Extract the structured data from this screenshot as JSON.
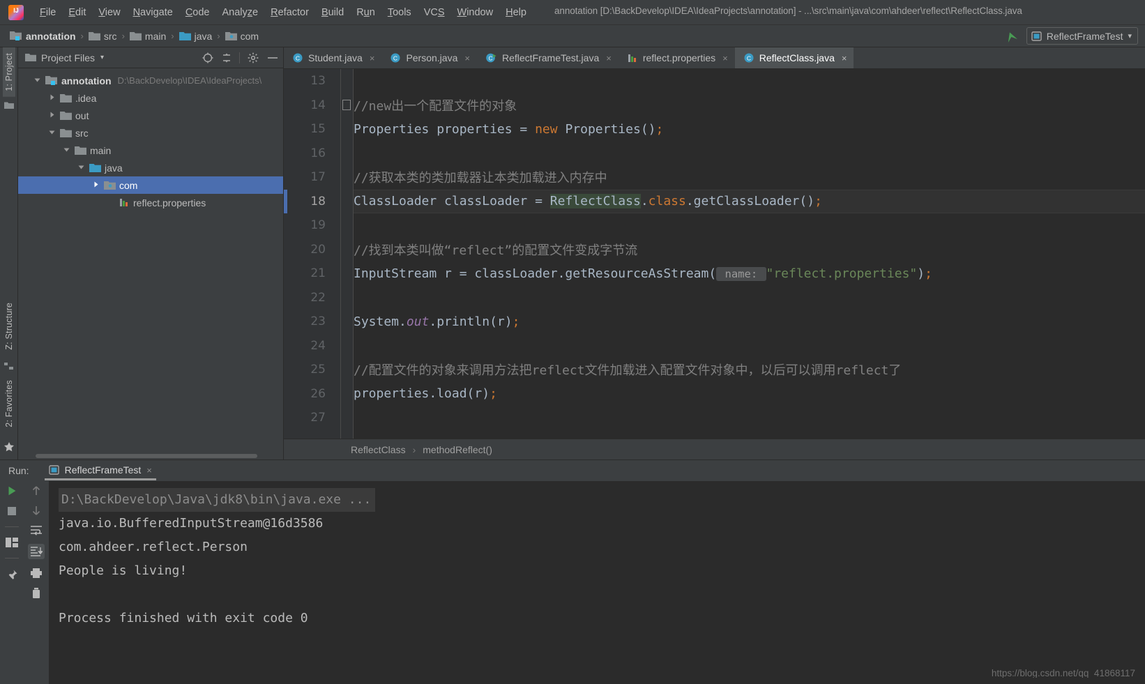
{
  "window": {
    "title": "annotation [D:\\BackDevelop\\IDEA\\IdeaProjects\\annotation] - ...\\src\\main\\java\\com\\ahdeer\\reflect\\ReflectClass.java"
  },
  "menubar": {
    "logo": "intellij-idea-logo",
    "items": [
      {
        "label": "File",
        "pre": "F",
        "mid": "ile"
      },
      {
        "label": "Edit",
        "pre": "E",
        "mid": "dit"
      },
      {
        "label": "View",
        "pre": "V",
        "mid": "iew"
      },
      {
        "label": "Navigate",
        "pre": "N",
        "mid": "avigate"
      },
      {
        "label": "Code",
        "pre": "C",
        "mid": "ode"
      },
      {
        "label": "Analyze",
        "pre": "z",
        "mid": "Analyze"
      },
      {
        "label": "Refactor",
        "pre": "R",
        "mid": "efactor"
      },
      {
        "label": "Build",
        "pre": "B",
        "mid": "uild"
      },
      {
        "label": "Run",
        "pre": "u",
        "mid": "Run"
      },
      {
        "label": "Tools",
        "pre": "T",
        "mid": "ools"
      },
      {
        "label": "VCS",
        "pre": "S",
        "mid": "VCS"
      },
      {
        "label": "Window",
        "pre": "W",
        "mid": "indow"
      },
      {
        "label": "Help",
        "pre": "H",
        "mid": "elp"
      }
    ]
  },
  "navbar": {
    "breadcrumbs": [
      {
        "label": "annotation",
        "icon": "module-folder-icon",
        "bold": true
      },
      {
        "label": "src",
        "icon": "folder-icon",
        "bold": false
      },
      {
        "label": "main",
        "icon": "folder-icon",
        "bold": false
      },
      {
        "label": "java",
        "icon": "source-folder-icon",
        "bold": false
      },
      {
        "label": "com",
        "icon": "package-folder-icon",
        "bold": false
      }
    ],
    "separator": "›",
    "run_config": {
      "label": "ReflectFrameTest",
      "icon": "run-config-icon",
      "dropdown": "▾"
    },
    "back_arrow_icon": "navigate-back-arrow-icon"
  },
  "project_panel": {
    "title": "Project Files",
    "title_dropdown": "▾",
    "toolbar_icons": [
      "locate-target-icon",
      "collapse-all-icon",
      "settings-gear-icon",
      "hide-minimize-icon"
    ],
    "vertical_tabs": [
      {
        "label": "1: Project",
        "pre": "1",
        "active": true
      },
      {
        "label": "Z: Structure",
        "pre": "Z",
        "active": false
      },
      {
        "label": "2: Favorites",
        "pre": "2",
        "active": false
      }
    ],
    "tree": [
      {
        "indent": 0,
        "twisty": "down",
        "icon": "module-folder-icon",
        "name": "annotation",
        "bold": true,
        "path": "D:\\BackDevelop\\IDEA\\IdeaProjects\\",
        "selected": false
      },
      {
        "indent": 1,
        "twisty": "right",
        "icon": "folder-icon",
        "name": ".idea",
        "bold": false,
        "path": "",
        "selected": false
      },
      {
        "indent": 1,
        "twisty": "right",
        "icon": "folder-icon",
        "name": "out",
        "bold": false,
        "path": "",
        "selected": false
      },
      {
        "indent": 1,
        "twisty": "down",
        "icon": "folder-icon",
        "name": "src",
        "bold": false,
        "path": "",
        "selected": false
      },
      {
        "indent": 2,
        "twisty": "down",
        "icon": "folder-icon",
        "name": "main",
        "bold": false,
        "path": "",
        "selected": false
      },
      {
        "indent": 3,
        "twisty": "down",
        "icon": "source-folder-icon",
        "name": "java",
        "bold": false,
        "path": "",
        "selected": false
      },
      {
        "indent": 4,
        "twisty": "right",
        "icon": "package-folder-icon",
        "name": "com",
        "bold": false,
        "path": "",
        "selected": true
      },
      {
        "indent": 5,
        "twisty": "none",
        "icon": "properties-file-icon",
        "name": "reflect.properties",
        "bold": false,
        "path": "",
        "selected": false
      }
    ]
  },
  "editor": {
    "tabs": [
      {
        "label": "Student.java",
        "icon": "java-class-icon",
        "active": false,
        "close": "×"
      },
      {
        "label": "Person.java",
        "icon": "java-class-icon",
        "active": false,
        "close": "×"
      },
      {
        "label": "ReflectFrameTest.java",
        "icon": "java-runnable-class-icon",
        "active": false,
        "close": "×"
      },
      {
        "label": "reflect.properties",
        "icon": "properties-file-icon",
        "active": false,
        "close": "×"
      },
      {
        "label": "ReflectClass.java",
        "icon": "java-class-icon",
        "active": true,
        "close": "×"
      }
    ],
    "breadcrumb": {
      "class": "ReflectClass",
      "separator": "›",
      "method": "methodReflect()"
    },
    "lines": [
      {
        "num": "13",
        "current": false,
        "fold": false,
        "tokens": []
      },
      {
        "num": "14",
        "current": false,
        "fold": true,
        "tokens": [
          {
            "t": "//new出一个配置文件的对象",
            "c": "cmt"
          }
        ]
      },
      {
        "num": "15",
        "current": false,
        "fold": false,
        "tokens": [
          {
            "t": "Properties properties = ",
            "c": "pun"
          },
          {
            "t": "new",
            "c": "kw"
          },
          {
            "t": " Properties()",
            "c": "pun"
          },
          {
            "t": ";",
            "c": "semi"
          }
        ]
      },
      {
        "num": "16",
        "current": false,
        "fold": false,
        "tokens": []
      },
      {
        "num": "17",
        "current": false,
        "fold": false,
        "tokens": [
          {
            "t": "//获取本类的类加载器让本类加载进入内存中",
            "c": "cmt"
          }
        ]
      },
      {
        "num": "18",
        "current": true,
        "fold": false,
        "tokens": [
          {
            "t": "ClassLoader classLoader = ",
            "c": "pun"
          },
          {
            "t": "ReflectClass",
            "c": "hlid"
          },
          {
            "t": ".",
            "c": "pun"
          },
          {
            "t": "class",
            "c": "kw"
          },
          {
            "t": ".getClassLoader()",
            "c": "pun"
          },
          {
            "t": ";",
            "c": "semi"
          }
        ]
      },
      {
        "num": "19",
        "current": false,
        "fold": false,
        "tokens": []
      },
      {
        "num": "20",
        "current": false,
        "fold": false,
        "tokens": [
          {
            "t": "//找到本类叫做“reflect”的配置文件变成字节流",
            "c": "cmt"
          }
        ]
      },
      {
        "num": "21",
        "current": false,
        "fold": false,
        "tokens": [
          {
            "t": "InputStream r = classLoader.getResourceAsStream(",
            "c": "pun"
          },
          {
            "t": " name: ",
            "c": "phint"
          },
          {
            "t": "\"reflect.properties\"",
            "c": "str"
          },
          {
            "t": ")",
            "c": "pun"
          },
          {
            "t": ";",
            "c": "semi"
          }
        ]
      },
      {
        "num": "22",
        "current": false,
        "fold": false,
        "tokens": []
      },
      {
        "num": "23",
        "current": false,
        "fold": false,
        "tokens": [
          {
            "t": "System.",
            "c": "pun"
          },
          {
            "t": "out",
            "c": "fld"
          },
          {
            "t": ".println(r)",
            "c": "pun"
          },
          {
            "t": ";",
            "c": "semi"
          }
        ]
      },
      {
        "num": "24",
        "current": false,
        "fold": false,
        "tokens": []
      },
      {
        "num": "25",
        "current": false,
        "fold": false,
        "tokens": [
          {
            "t": "//配置文件的对象来调用方法把reflect文件加载进入配置文件对象中，以后可以调用reflect了",
            "c": "cmt"
          }
        ]
      },
      {
        "num": "26",
        "current": false,
        "fold": false,
        "tokens": [
          {
            "t": "properties.load(r)",
            "c": "pun"
          },
          {
            "t": ";",
            "c": "semi"
          }
        ]
      },
      {
        "num": "27",
        "current": false,
        "fold": false,
        "tokens": []
      }
    ]
  },
  "run_panel": {
    "label": "Run:",
    "tab": {
      "label": "ReflectFrameTest",
      "icon": "run-config-icon",
      "close": "×"
    },
    "toolbar_left": [
      "rerun-play-icon",
      "stop-icon",
      "layout-icon",
      "pin-icon"
    ],
    "toolbar_right": [
      "up-arrow-icon",
      "down-arrow-icon",
      "soft-wrap-icon",
      "scroll-to-end-icon",
      "print-icon",
      "trash-icon"
    ],
    "console": [
      {
        "text": "D:\\BackDevelop\\Java\\jdk8\\bin\\java.exe ...",
        "style": "cmdpath"
      },
      {
        "text": "java.io.BufferedInputStream@16d3586",
        "style": "normal"
      },
      {
        "text": "com.ahdeer.reflect.Person",
        "style": "normal"
      },
      {
        "text": "People is living!",
        "style": "normal"
      },
      {
        "text": "",
        "style": "normal"
      },
      {
        "text": "Process finished with exit code 0",
        "style": "normal"
      }
    ]
  },
  "watermark": "https://blog.csdn.net/qq_41868117",
  "colors": {
    "background": "#3c3f41",
    "editor_bg": "#2b2b2b",
    "gutter_bg": "#313335",
    "selection_blue": "#4b6eaf",
    "accent_teal": "#3b9bc4",
    "keyword_orange": "#cc7832",
    "string_green": "#6a8759",
    "field_purple": "#9876aa",
    "comment_gray": "#808080",
    "code_gray": "#a9b7c6",
    "run_green": "#499c54"
  }
}
